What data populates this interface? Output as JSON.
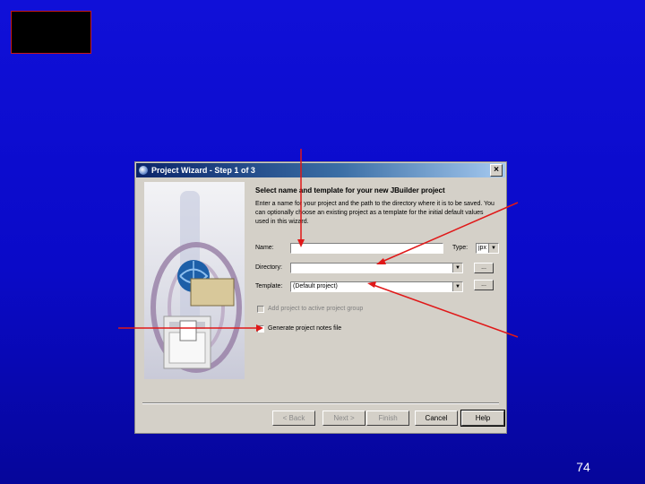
{
  "slide": {
    "page_number": "74"
  },
  "dialog": {
    "title": "Project Wizard - Step 1 of 3",
    "close_glyph": "×",
    "heading": "Select name and template for your new JBuilder project",
    "description": "Enter a name for your project and the path to the directory where it is to be saved. You can optionally choose an existing project as a template for the initial default values used in this wizard.",
    "name": {
      "label": "Name:",
      "value": ""
    },
    "type": {
      "label": "Type:",
      "value": "jpx"
    },
    "directory": {
      "label": "Directory:",
      "value": ""
    },
    "template": {
      "label": "Template:",
      "value": "(Default project)"
    },
    "browse_label": "...",
    "add_to_group": {
      "label": "Add project to active project group",
      "enabled": false
    },
    "generate_notes": {
      "label": "Generate project notes file",
      "checked": false
    },
    "buttons": {
      "back": "< Back",
      "next": "Next >",
      "finish": "Finish",
      "cancel": "Cancel",
      "help": "Help"
    }
  },
  "annotation_color": "#e01818"
}
